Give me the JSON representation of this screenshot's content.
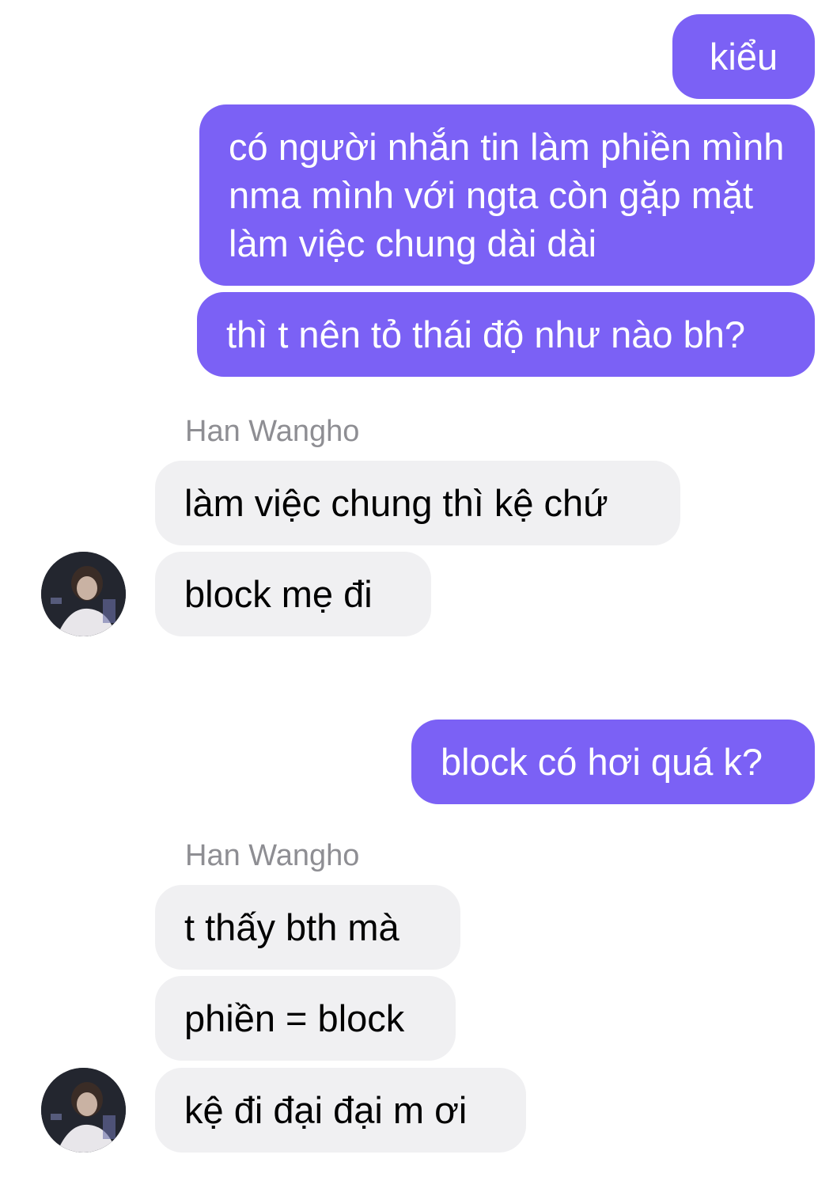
{
  "conversation": {
    "sent_group_1": [
      "kiểu",
      "có người nhắn tin làm phiền mình nma mình với ngta còn gặp mặt làm việc chung dài dài",
      "thì t nên tỏ thái độ như nào bh?"
    ],
    "received_group_1": {
      "sender": "Han Wangho",
      "messages": [
        "làm việc chung thì kệ chứ",
        "block mẹ đi"
      ]
    },
    "sent_group_2": [
      "block có hơi quá k?"
    ],
    "received_group_2": {
      "sender": "Han Wangho",
      "messages": [
        "t thấy bth mà",
        "phiền = block",
        "kệ đi đại đại m ơi"
      ]
    }
  },
  "colors": {
    "outgoing_bubble": "#7b61f5",
    "incoming_bubble": "#f0f0f2",
    "sender_name": "#8e8e93"
  }
}
